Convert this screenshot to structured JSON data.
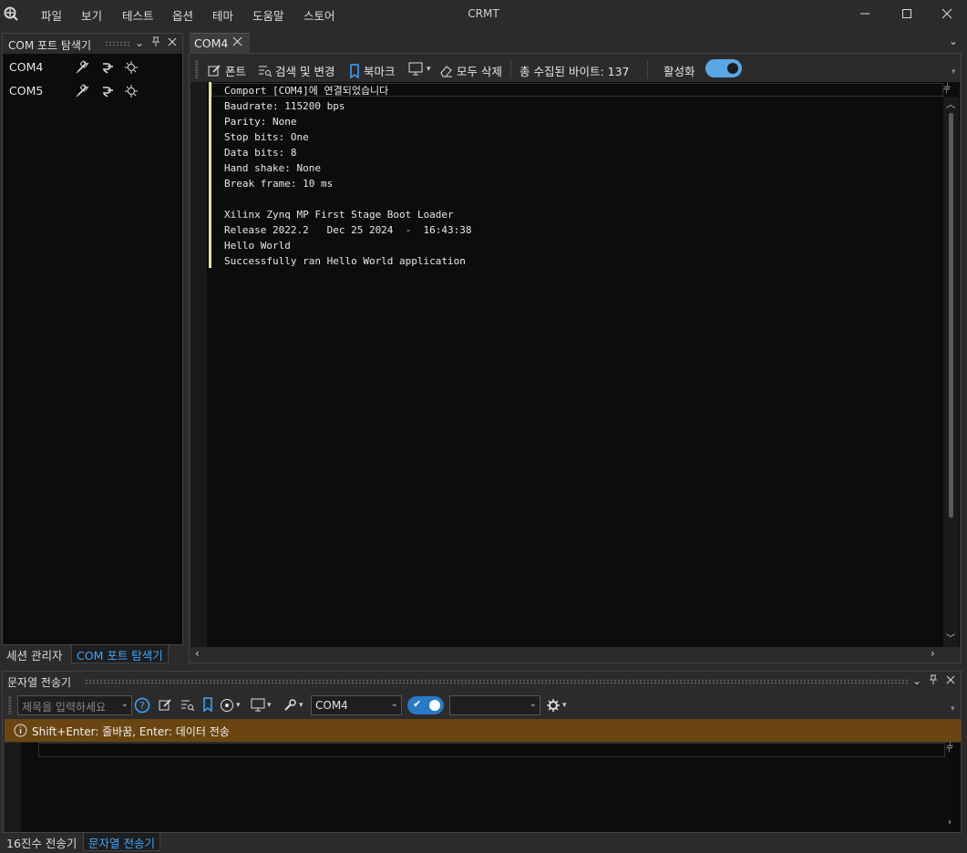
{
  "menu": [
    "파일",
    "보기",
    "테스트",
    "옵션",
    "테마",
    "도움말",
    "스토어"
  ],
  "app_title": "CRMT",
  "left_panel": {
    "title": "COM 포트 탐색기",
    "ports": [
      {
        "name": "COM4"
      },
      {
        "name": "COM5"
      }
    ],
    "tabs": [
      "세션 관리자",
      "COM 포트 탐색기"
    ],
    "active_tab": "COM 포트 탐색기"
  },
  "doc_tab": {
    "label": "COM4"
  },
  "toolbar": {
    "font_label": "폰트",
    "search_label": "검색 및 변경",
    "bookmark_label": "북마크",
    "clear_label": "모두 삭제",
    "bytes_label": "총 수집된 바이트: 137",
    "enable_label": "활성화"
  },
  "console_lines": [
    "Comport [COM4]에 연결되었습니다",
    "Baudrate: 115200 bps",
    "Parity: None",
    "Stop bits: One",
    "Data bits: 8",
    "Hand shake: None",
    "Break frame: 10 ms",
    "",
    "Xilinx Zynq MP First Stage Boot Loader",
    "Release 2022.2   Dec 25 2024  -  16:43:38",
    "Hello World",
    "Successfully ran Hello World application"
  ],
  "bottom_panel": {
    "title": "문자열 전송기",
    "title_placeholder": "제목을 입력하세요",
    "port_select": "COM4",
    "second_select": "",
    "info": "Shift+Enter: 줄바꿈, Enter: 데이터 전송",
    "tabs": [
      "16진수 전송기",
      "문자열 전송기"
    ],
    "active_tab": "문자열 전송기"
  },
  "colors": {
    "accent": "#5aa7e6",
    "info_bar": "#6b4511",
    "tab_active_text": "#3ea6ff"
  }
}
